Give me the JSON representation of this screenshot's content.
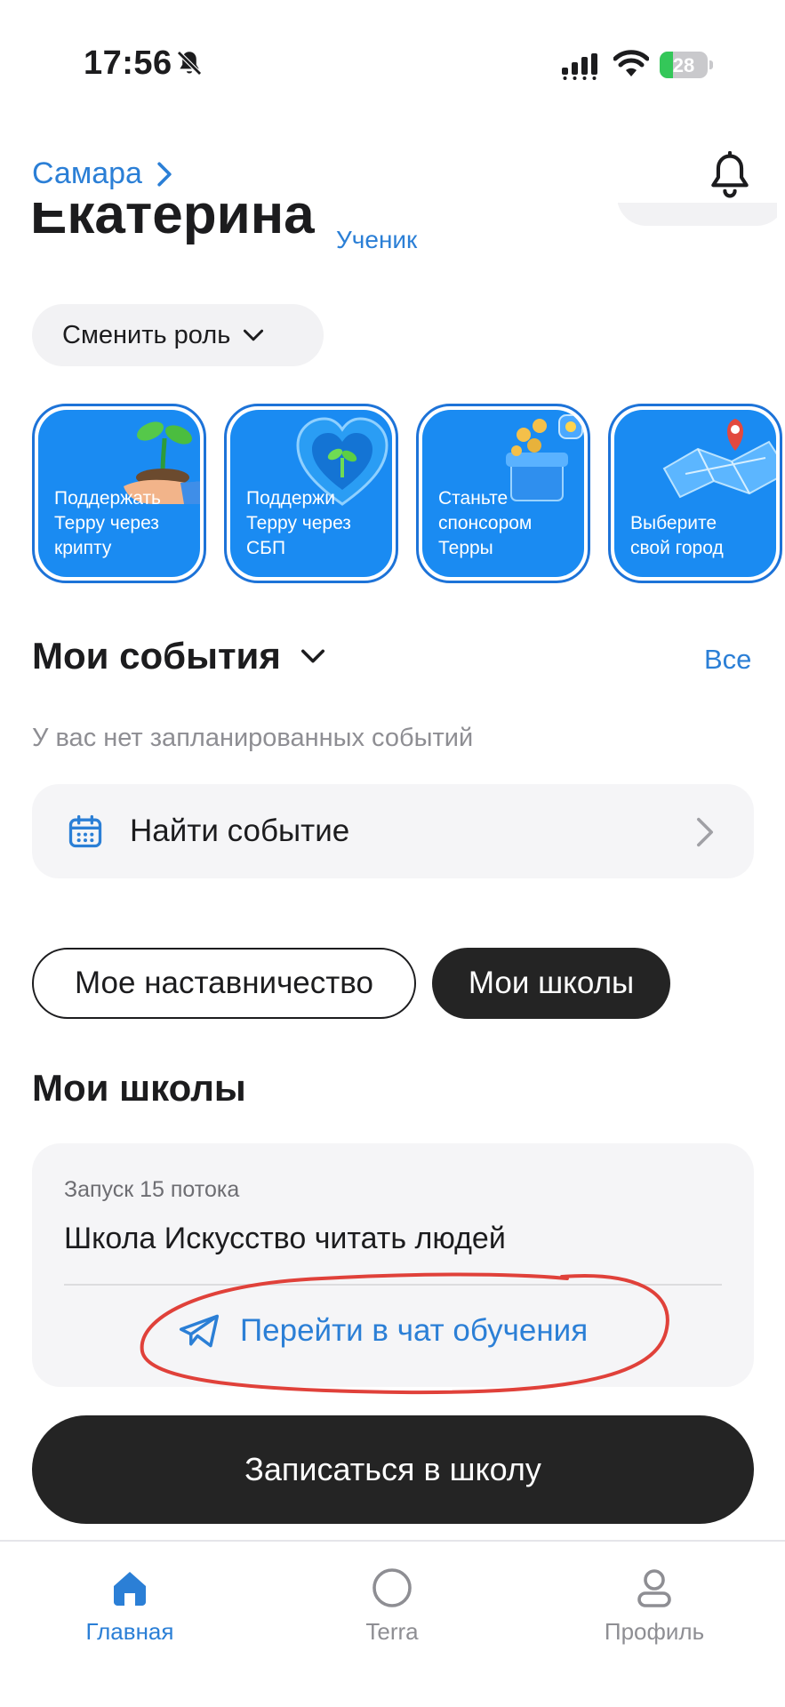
{
  "status_bar": {
    "time": "17:56",
    "battery": "28",
    "battery_level_percent": 28
  },
  "header": {
    "city": "Самара"
  },
  "user": {
    "name": "Екатерина",
    "role": "Ученик",
    "switch_role_label": "Сменить роль"
  },
  "promo_cards": [
    {
      "label": "Поддержать\nТерру через\nкрипту",
      "icon": "sprout-hand-icon"
    },
    {
      "label": "Поддержи\nТерру через\nСБП",
      "icon": "heart-sprout-icon"
    },
    {
      "label": "Станьте\nспонсором\nТерры",
      "icon": "gift-coins-icon"
    },
    {
      "label": "Выберите\nсвой город",
      "icon": "map-pin-icon"
    }
  ],
  "events": {
    "title": "Мои события",
    "all_label": "Все",
    "empty_text": "У вас нет запланированных событий",
    "find_label": "Найти событие"
  },
  "tabs": {
    "mentoring": "Мое наставничество",
    "schools": "Мои школы",
    "active": "schools"
  },
  "schools": {
    "title": "Мои школы",
    "card": {
      "subtitle": "Запуск 15 потока",
      "name": "Школа Искусство читать людей",
      "chat_label": "Перейти в чат обучения"
    },
    "enroll_label": "Записаться в школу"
  },
  "tabbar": {
    "home": "Главная",
    "terra": "Terra",
    "profile": "Профиль",
    "active": "home"
  },
  "colors": {
    "accent": "#2b7fd6",
    "card_blue": "#1a8bf2",
    "dark_button": "#242424",
    "annotation_red": "#e0413a"
  }
}
